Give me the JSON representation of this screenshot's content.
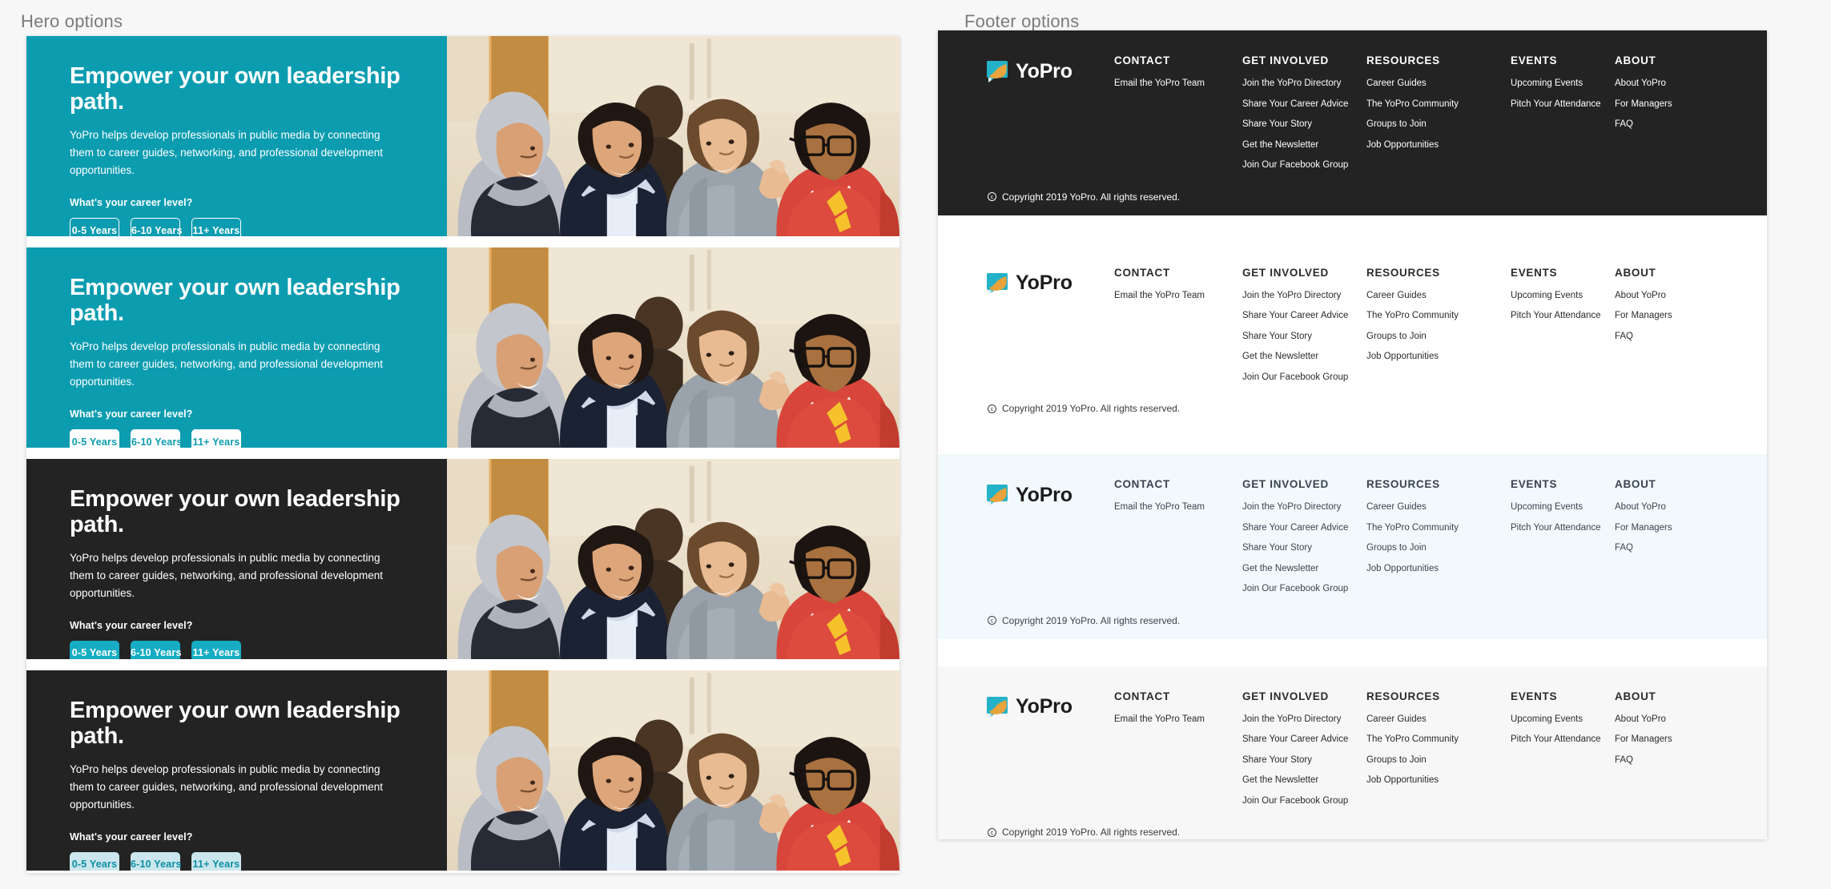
{
  "sections": {
    "hero_label": "Hero options",
    "footer_label": "Footer options"
  },
  "hero": {
    "heading": "Empower your own leadership path.",
    "body": "YoPro helps develop professionals in public media by connecting them to career guides, networking, and professional development opportunities.",
    "prompt": "What's your career level?",
    "buttons": [
      {
        "label": "0-5 Years"
      },
      {
        "label": "6-10 Years"
      },
      {
        "label": "11+ Years"
      }
    ],
    "image_alt": "Four smiling professionals seated in a row at an event",
    "variants": [
      {
        "id": "hero-variant-teal-outline",
        "style": "v-teal",
        "bg": "#0c9cb0",
        "button_style": "outline-white"
      },
      {
        "id": "hero-variant-teal-solid",
        "style": "v-teal-solid",
        "bg": "#0c9cb0",
        "button_style": "solid-white"
      },
      {
        "id": "hero-variant-dark-teal",
        "style": "v-dark",
        "bg": "#232323",
        "button_style": "solid-teal"
      },
      {
        "id": "hero-variant-dark-pale",
        "style": "v-dark-pale",
        "bg": "#232323",
        "button_style": "solid-pale-blue"
      }
    ]
  },
  "footer": {
    "logo_text": "YoPro",
    "copyright": "Copyright 2019 YoPro. All rights reserved.",
    "columns": [
      {
        "heading": "CONTACT",
        "links": [
          "Email the YoPro Team"
        ]
      },
      {
        "heading": "GET INVOLVED",
        "links": [
          "Join the YoPro Directory",
          "Share Your Career Advice",
          "Share Your Story",
          "Get the Newsletter",
          "Join Our Facebook Group"
        ]
      },
      {
        "heading": "RESOURCES",
        "links": [
          "Career Guides",
          "The YoPro Community",
          "Groups to Join",
          "Job Opportunities"
        ]
      },
      {
        "heading": "EVENTS",
        "links": [
          "Upcoming Events",
          "Pitch Your Attendance"
        ]
      },
      {
        "heading": "ABOUT",
        "links": [
          "About YoPro",
          "For Managers",
          "FAQ"
        ]
      }
    ],
    "variants": [
      {
        "id": "footer-variant-dark",
        "style": "f-dark",
        "bg": "#232323"
      },
      {
        "id": "footer-variant-white",
        "style": "f-white",
        "bg": "#ffffff"
      },
      {
        "id": "footer-variant-lightblue",
        "style": "f-blue",
        "bg": "#f2f9fc"
      },
      {
        "id": "footer-variant-gray",
        "style": "f-gray",
        "bg": "#f7f7f7"
      }
    ]
  },
  "colors": {
    "teal": "#0c9cb0",
    "teal_bright": "#16adc4",
    "pale_blue": "#cbe6ed",
    "dark": "#232323",
    "light_blue_bg": "#f2f9fc",
    "page_bg": "#f7f7f7",
    "logo_orange": "#e8a33c",
    "logo_teal": "#23b2c8"
  }
}
